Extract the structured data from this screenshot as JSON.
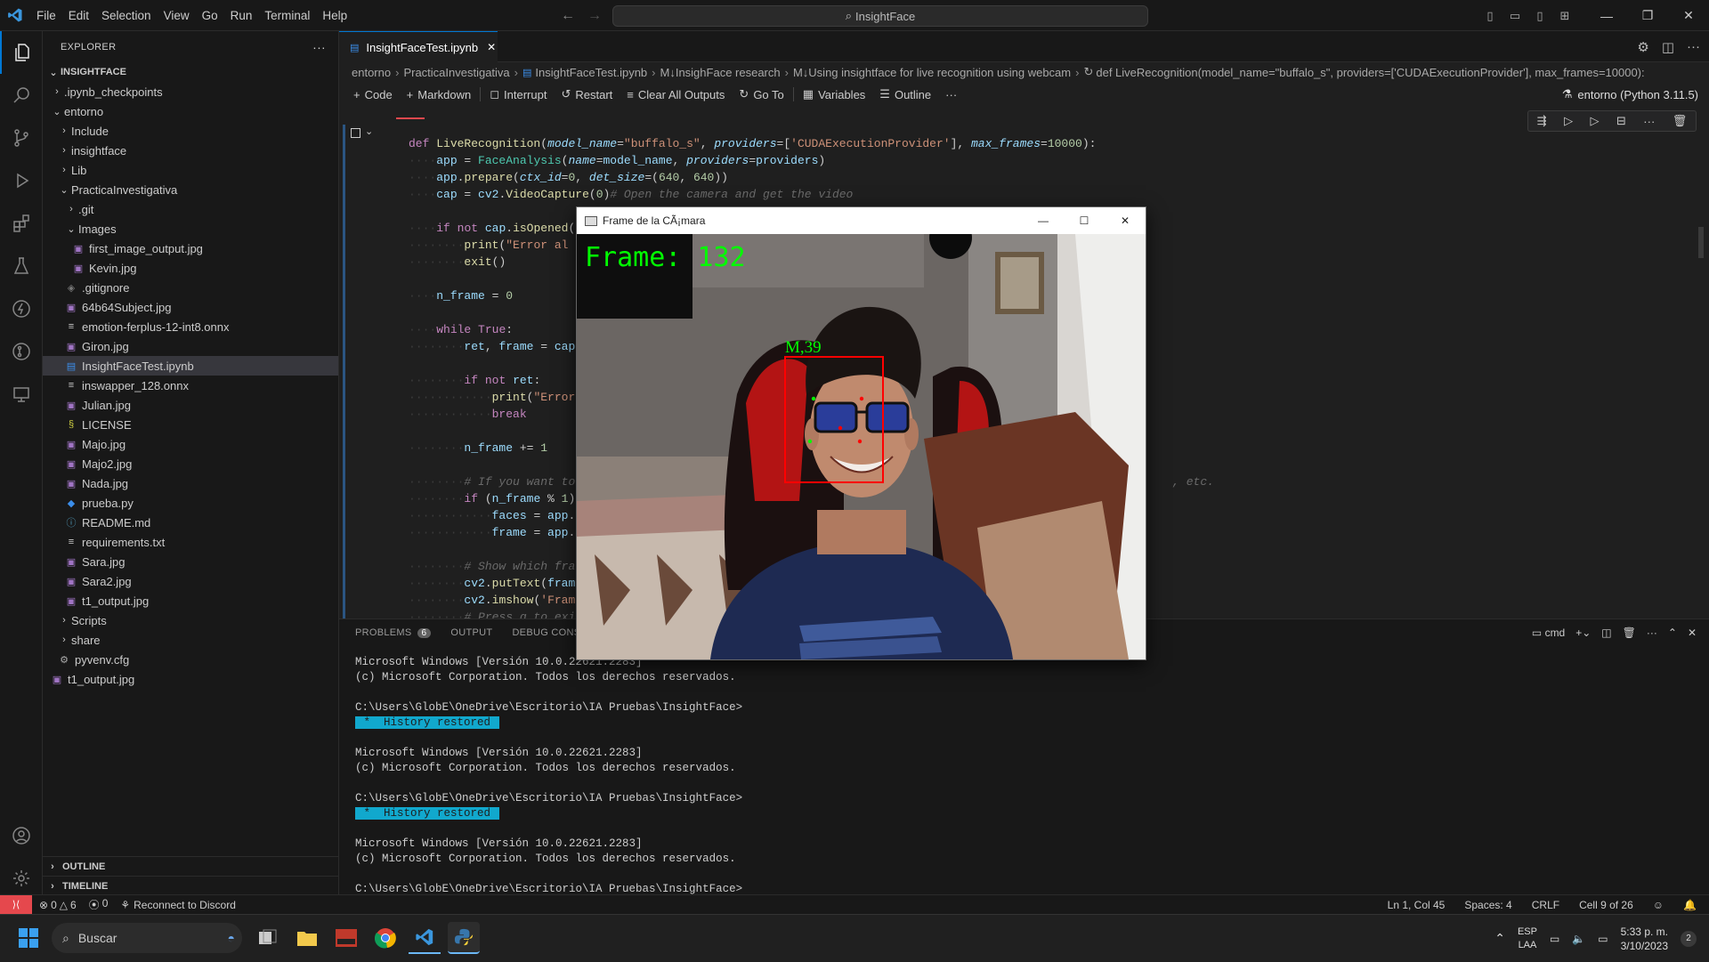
{
  "menu": [
    "File",
    "Edit",
    "Selection",
    "View",
    "Go",
    "Run",
    "Terminal",
    "Help"
  ],
  "command_center": "InsightFace",
  "explorer": {
    "title": "EXPLORER",
    "root": "INSIGHTFACE",
    "items": [
      {
        "label": ".ipynb_checkpoints",
        "type": "folder",
        "state": "closed",
        "depth": 1
      },
      {
        "label": "entorno",
        "type": "folder",
        "state": "open",
        "depth": 1
      },
      {
        "label": "Include",
        "type": "folder",
        "state": "closed",
        "depth": 2
      },
      {
        "label": "insightface",
        "type": "folder",
        "state": "closed",
        "depth": 2
      },
      {
        "label": "Lib",
        "type": "folder",
        "state": "closed",
        "depth": 2
      },
      {
        "label": "PracticaInvestigativa",
        "type": "folder",
        "state": "open",
        "depth": 2
      },
      {
        "label": ".git",
        "type": "folder",
        "state": "closed",
        "depth": 3
      },
      {
        "label": "Images",
        "type": "folder",
        "state": "open",
        "depth": 3
      },
      {
        "label": "first_image_output.jpg",
        "type": "img",
        "depth": 4
      },
      {
        "label": "Kevin.jpg",
        "type": "img",
        "depth": 4
      },
      {
        "label": ".gitignore",
        "type": "git",
        "depth": 3
      },
      {
        "label": "64b64Subject.jpg",
        "type": "img",
        "depth": 3
      },
      {
        "label": "emotion-ferplus-12-int8.onnx",
        "type": "txt",
        "depth": 3
      },
      {
        "label": "Giron.jpg",
        "type": "img",
        "depth": 3
      },
      {
        "label": "InsightFaceTest.ipynb",
        "type": "nb",
        "depth": 3,
        "selected": true
      },
      {
        "label": "inswapper_128.onnx",
        "type": "txt",
        "depth": 3
      },
      {
        "label": "Julian.jpg",
        "type": "img",
        "depth": 3
      },
      {
        "label": "LICENSE",
        "type": "lic",
        "depth": 3
      },
      {
        "label": "Majo.jpg",
        "type": "img",
        "depth": 3
      },
      {
        "label": "Majo2.jpg",
        "type": "img",
        "depth": 3
      },
      {
        "label": "Nada.jpg",
        "type": "img",
        "depth": 3
      },
      {
        "label": "prueba.py",
        "type": "py",
        "depth": 3
      },
      {
        "label": "README.md",
        "type": "md",
        "depth": 3
      },
      {
        "label": "requirements.txt",
        "type": "txt",
        "depth": 3
      },
      {
        "label": "Sara.jpg",
        "type": "img",
        "depth": 3
      },
      {
        "label": "Sara2.jpg",
        "type": "img",
        "depth": 3
      },
      {
        "label": "t1_output.jpg",
        "type": "img",
        "depth": 3
      },
      {
        "label": "Scripts",
        "type": "folder",
        "state": "closed",
        "depth": 2
      },
      {
        "label": "share",
        "type": "folder",
        "state": "closed",
        "depth": 2
      },
      {
        "label": "pyvenv.cfg",
        "type": "gear",
        "depth": 2
      },
      {
        "label": "t1_output.jpg",
        "type": "img",
        "depth": 1
      }
    ],
    "outline": "OUTLINE",
    "timeline": "TIMELINE"
  },
  "tab": {
    "label": "InsightFaceTest.ipynb"
  },
  "breadcrumb": [
    "entorno",
    "PracticaInvestigativa",
    "InsightFaceTest.ipynb",
    "M↓InsighFace research",
    "M↓Using insightface for live recognition using webcam",
    "def LiveRecognition(model_name=\"buffalo_s\", providers=['CUDAExecutionProvider'], max_frames=10000):"
  ],
  "toolbar": {
    "code": "Code",
    "markdown": "Markdown",
    "interrupt": "Interrupt",
    "restart": "Restart",
    "clear": "Clear All Outputs",
    "goto": "Go To",
    "variables": "Variables",
    "outline": "Outline"
  },
  "kernel": "entorno (Python 3.11.5)",
  "panel": {
    "tabs": [
      "PROBLEMS",
      "OUTPUT",
      "DEBUG CONSOLE"
    ],
    "problems_count": "6",
    "shell": "cmd",
    "terminal": {
      "win_line": "Microsoft Windows [Versión 10.0.22621.2283]",
      "corp_line": "(c) Microsoft Corporation. Todos los derechos reservados.",
      "prompt": "C:\\Users\\GlobE\\OneDrive\\Escritorio\\IA Pruebas\\InsightFace>",
      "restored": " *  History restored "
    }
  },
  "camera_window": {
    "title": "Frame de la CÃ¡mara",
    "frame_text": "Frame: 132",
    "face_label": "M,39"
  },
  "status": {
    "errors": "0",
    "warnings": "6",
    "ports": "0",
    "discord": "Reconnect to Discord",
    "position": "Ln 1, Col 45",
    "spaces": "Spaces: 4",
    "eol": "CRLF",
    "cell": "Cell 9 of 26"
  },
  "taskbar": {
    "search": "Buscar",
    "lang1": "ESP",
    "lang2": "LAA",
    "time": "5:33 p. m.",
    "date": "3/10/2023",
    "notif": "2"
  },
  "colors": {
    "accent": "#0078d4",
    "green_text": "#00ff00",
    "box_red": "#ff0000"
  }
}
